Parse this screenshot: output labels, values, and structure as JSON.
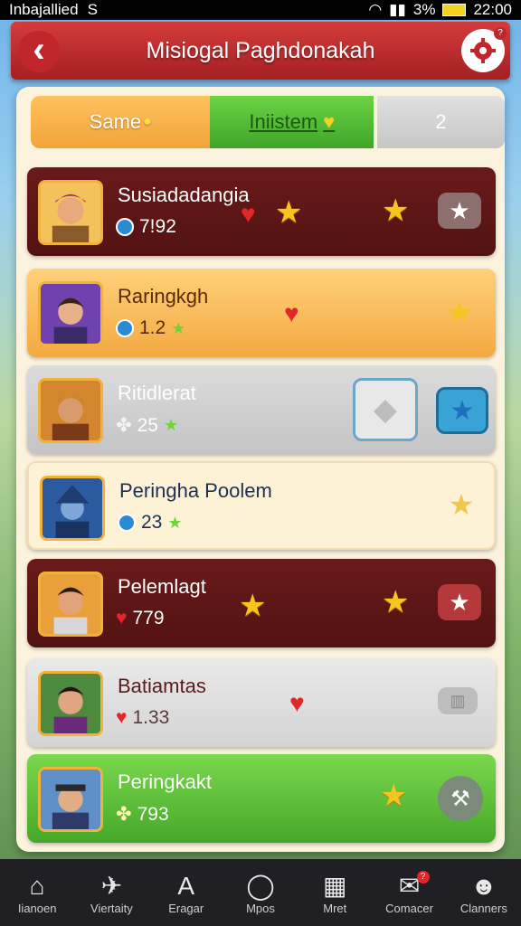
{
  "status": {
    "left": "Inbajallied",
    "carrier_mark": "S",
    "battery": "3%",
    "time": "22:00"
  },
  "header": {
    "title": "Misiogal Paghdonakah",
    "gear_badge": "?"
  },
  "tabs": [
    {
      "label": "Same"
    },
    {
      "label": "Iniistem"
    },
    {
      "label": "2"
    }
  ],
  "cards": [
    {
      "name": "Susiadadangia",
      "stat": "7!92",
      "style": "dark"
    },
    {
      "name": "Raringkgh",
      "stat": "1.2",
      "style": "orange"
    },
    {
      "name": "Ritidlerat",
      "stat": "25",
      "style": "gray"
    },
    {
      "name": "Peringha Poolem",
      "stat": "23",
      "style": "cream"
    },
    {
      "name": "Pelemlagt",
      "stat": "779",
      "style": "dark"
    },
    {
      "name": "Batiamtas",
      "stat": "1.33",
      "style": "light"
    },
    {
      "name": "Peringkakt",
      "stat": "793",
      "style": "green"
    }
  ],
  "nav": [
    {
      "label": "Iianoen",
      "icon": "home-icon",
      "badge": ""
    },
    {
      "label": "Viertaity",
      "icon": "rocket-icon",
      "badge": ""
    },
    {
      "label": "Eragar",
      "icon": "letter-a-icon",
      "badge": ""
    },
    {
      "label": "Mpos",
      "icon": "chat-icon",
      "badge": ""
    },
    {
      "label": "Mret",
      "icon": "grid-icon",
      "badge": ""
    },
    {
      "label": "Comacer",
      "icon": "mail-icon",
      "badge": "?"
    },
    {
      "label": "Clanners",
      "icon": "profile-icon",
      "badge": ""
    }
  ],
  "colors": {
    "header": "#c0262b",
    "panel": "#fbf3de",
    "accent_green": "#46a82a",
    "accent_orange": "#f3a941"
  }
}
